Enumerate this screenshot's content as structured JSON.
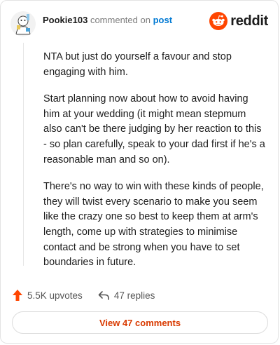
{
  "comment": {
    "username": "Pookie103",
    "action_text": "commented on",
    "post_link": "post",
    "paragraphs": [
      "NTA but just do yourself a favour and stop engaging with him.",
      "Start planning now about how to avoid having him at your wedding (it might mean stepmum also can't be there judging by her reaction to this - so plan carefully, speak to your dad first if he's a reasonable man and so on).",
      "There's no way to win with these kinds of people, they will twist every scenario to make you seem like the crazy one so best to keep them at arm's length, come up with strategies to minimise contact and be strong when you have to set boundaries in future."
    ]
  },
  "brand": {
    "name": "reddit",
    "icon": "reddit-snoo-icon",
    "color": "#ff4500"
  },
  "actions": {
    "upvotes": "5.5K upvotes",
    "replies": "47 replies",
    "upvote_icon": "upvote-arrow-icon",
    "reply_icon": "reply-arrow-icon"
  },
  "view_button": {
    "label": "View 47 comments"
  },
  "colors": {
    "accent": "#ff4500",
    "link": "#0079d3",
    "button_text": "#d93a00"
  }
}
